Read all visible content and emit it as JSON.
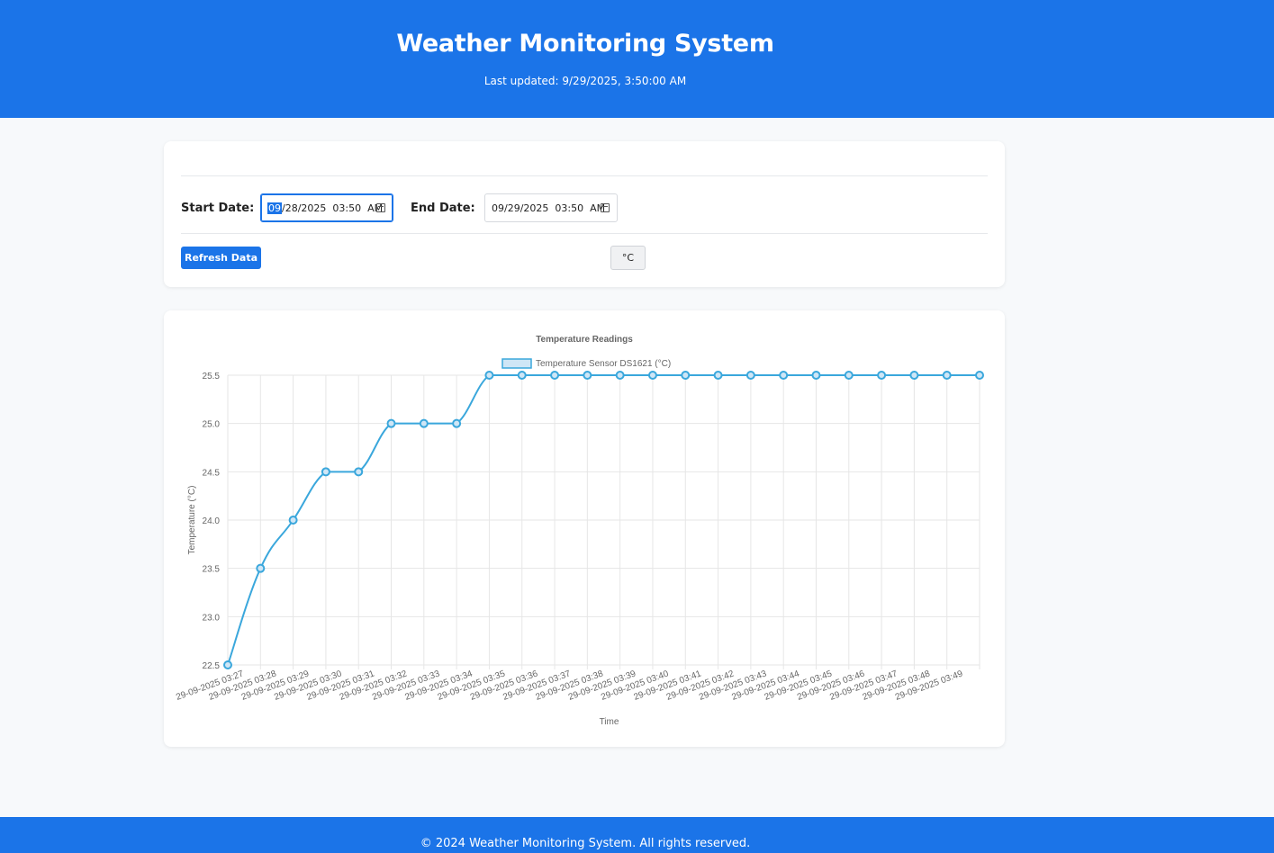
{
  "header": {
    "title": "Weather Monitoring System",
    "last_updated": "Last updated: 9/29/2025, 3:50:00 AM"
  },
  "controls": {
    "start_label": "Start Date:",
    "start_value": {
      "month": "09",
      "rest": "/28/2025  03:50  AM"
    },
    "end_label": "End Date:",
    "end_value": "09/29/2025  03:50  AM",
    "refresh_label": "Refresh Data",
    "unit_label": "°C"
  },
  "chart_data": {
    "type": "line",
    "title": "Temperature Readings",
    "xlabel": "Time",
    "ylabel": "Temperature (°C)",
    "ylim": [
      22.5,
      25.5
    ],
    "yticks": [
      22.5,
      23.0,
      23.5,
      24.0,
      24.5,
      25.0,
      25.5
    ],
    "grid": true,
    "legend_position": "top",
    "categories": [
      "29-09-2025 03:27",
      "29-09-2025 03:28",
      "29-09-2025 03:29",
      "29-09-2025 03:30",
      "29-09-2025 03:31",
      "29-09-2025 03:32",
      "29-09-2025 03:33",
      "29-09-2025 03:34",
      "29-09-2025 03:35",
      "29-09-2025 03:36",
      "29-09-2025 03:37",
      "29-09-2025 03:38",
      "29-09-2025 03:39",
      "29-09-2025 03:40",
      "29-09-2025 03:41",
      "29-09-2025 03:42",
      "29-09-2025 03:43",
      "29-09-2025 03:44",
      "29-09-2025 03:45",
      "29-09-2025 03:46",
      "29-09-2025 03:47",
      "29-09-2025 03:48",
      "29-09-2025 03:49"
    ],
    "series": [
      {
        "name": "Temperature Sensor DS1621 (°C)",
        "color": "#3aa7dc",
        "values": [
          22.5,
          23.5,
          24.0,
          24.5,
          24.5,
          25.0,
          25.0,
          25.0,
          25.5,
          25.5,
          25.5,
          25.5,
          25.5,
          25.5,
          25.5,
          25.5,
          25.5,
          25.5,
          25.5,
          25.5,
          25.5,
          25.5,
          25.5,
          25.5
        ]
      }
    ]
  },
  "footer": {
    "copyright": "© 2024 Weather Monitoring System. All rights reserved."
  }
}
